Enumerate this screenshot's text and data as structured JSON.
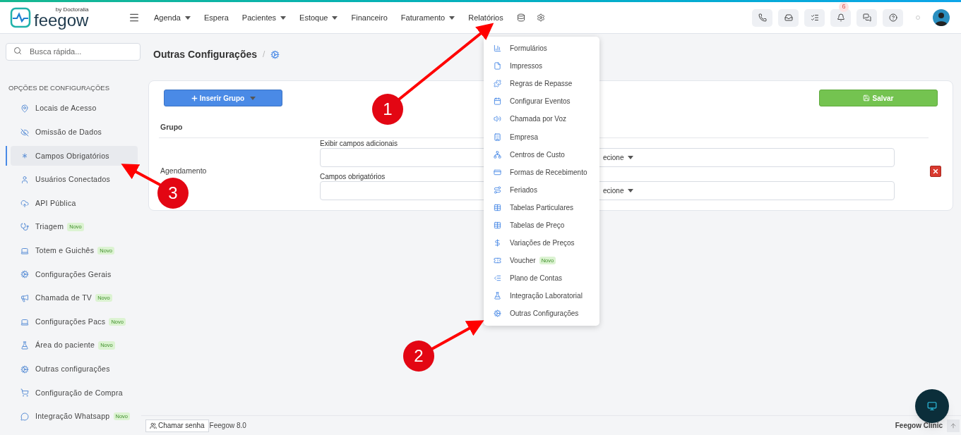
{
  "brand": {
    "name": "feegow",
    "byline": "by Doctoralia"
  },
  "nav": [
    {
      "label": "Agenda",
      "caret": true
    },
    {
      "label": "Espera",
      "caret": false
    },
    {
      "label": "Pacientes",
      "caret": true
    },
    {
      "label": "Estoque",
      "caret": true
    },
    {
      "label": "Financeiro",
      "caret": false
    },
    {
      "label": "Faturamento",
      "caret": true
    },
    {
      "label": "Relatórios",
      "caret": false
    }
  ],
  "notifications_count": "6",
  "search": {
    "placeholder": "Busca rápida..."
  },
  "breadcrumb": {
    "title": "Outras Configurações",
    "separator": "/"
  },
  "sidebar": {
    "heading": "OPÇÕES DE CONFIGURAÇÕES",
    "items": [
      {
        "label": "Locais de Acesso",
        "selected": false
      },
      {
        "label": "Omissão de Dados",
        "selected": false
      },
      {
        "label": "Campos Obrigatórios",
        "selected": true
      },
      {
        "label": "Usuários Conectados",
        "selected": false
      },
      {
        "label": "API Pública",
        "selected": false
      },
      {
        "label": "Triagem",
        "badge": "Novo",
        "selected": false
      },
      {
        "label": "Totem e Guichês",
        "badge": "Novo",
        "selected": false
      },
      {
        "label": "Configurações Gerais",
        "selected": false
      },
      {
        "label": "Chamada de TV",
        "badge": "Novo",
        "selected": false
      },
      {
        "label": "Configurações Pacs",
        "badge": "Novo",
        "selected": false
      },
      {
        "label": "Área do paciente",
        "badge": "Novo",
        "selected": false
      },
      {
        "label": "Outras configurações",
        "selected": false
      },
      {
        "label": "Configuração de Compra",
        "selected": false
      },
      {
        "label": "Integração Whatsapp",
        "badge": "Novo",
        "selected": false
      }
    ]
  },
  "card": {
    "insert_button": "Inserir Grupo",
    "save_button": "Salvar",
    "column": "Grupo",
    "row": {
      "group": "Agendamento",
      "fields": [
        {
          "label": "Exibir campos adicionais",
          "value": "ecione"
        },
        {
          "label": "Campos obrigatórios",
          "value": "ecione"
        }
      ]
    }
  },
  "dropdown": [
    {
      "label": "Formulários"
    },
    {
      "label": "Impressos"
    },
    {
      "label": "Regras de Repasse"
    },
    {
      "label": "Configurar Eventos"
    },
    {
      "label": "Chamada por Voz"
    },
    {
      "label": "Empresa"
    },
    {
      "label": "Centros de Custo"
    },
    {
      "label": "Formas de Recebimento"
    },
    {
      "label": "Feriados"
    },
    {
      "label": "Tabelas Particulares"
    },
    {
      "label": "Tabelas de Preço"
    },
    {
      "label": "Variações de Preços"
    },
    {
      "label": "Voucher",
      "badge": "Novo"
    },
    {
      "label": "Plano de Contas"
    },
    {
      "label": "Integração Laboratorial"
    },
    {
      "label": "Outras Configurações"
    }
  ],
  "footer": {
    "call_button": "Chamar senha",
    "version": "Feegow 8.0",
    "clinic": "Feegow Clinic"
  },
  "annotations": [
    "1",
    "2",
    "3"
  ]
}
